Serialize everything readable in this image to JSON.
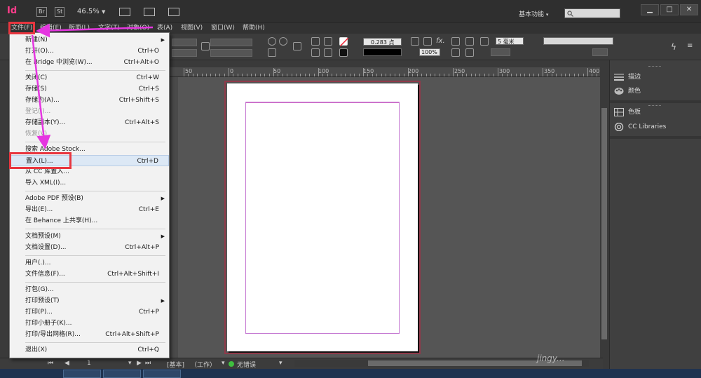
{
  "titlebar": {
    "logo": "Id",
    "br_label": "Br",
    "st_label": "St",
    "zoom": "46.5%",
    "workspace": "基本功能",
    "search_placeholder": ""
  },
  "window_controls": {
    "minimize": "▁",
    "maximize": "□",
    "close": "✕"
  },
  "menubar": {
    "items": [
      "文件(F)",
      "编辑(E)",
      "版面(L)",
      "文字(T)",
      "对象(O)",
      "表(A)",
      "视图(V)",
      "窗口(W)",
      "帮助(H)"
    ]
  },
  "control_bar": {
    "stroke_weight": "0.283 点",
    "opacity": "100%",
    "size": "5 毫米"
  },
  "ruler": {
    "labels": [
      "50",
      "0",
      "50",
      "100",
      "150",
      "200",
      "250",
      "300",
      "350",
      "400"
    ]
  },
  "panels": {
    "items": [
      {
        "label": "描边",
        "icon": "stroke-lines-icon"
      },
      {
        "label": "颜色",
        "icon": "color-palette-icon"
      },
      {
        "label": "色板",
        "icon": "swatches-grid-icon"
      },
      {
        "label": "CC Libraries",
        "icon": "cc-libraries-icon"
      }
    ]
  },
  "file_menu": {
    "items": [
      {
        "label": "新建(N)",
        "shortcut": "",
        "submenu": true
      },
      {
        "label": "打开(O)...",
        "shortcut": "Ctrl+O"
      },
      {
        "label": "在 Bridge 中浏览(W)...",
        "shortcut": "Ctrl+Alt+O"
      },
      {
        "sep": true
      },
      {
        "label": "关闭(C)",
        "shortcut": "Ctrl+W"
      },
      {
        "label": "存储(S)",
        "shortcut": "Ctrl+S"
      },
      {
        "label": "存储为(A)...",
        "shortcut": "Ctrl+Shift+S"
      },
      {
        "label": "登记(I)...",
        "shortcut": "",
        "disabled": true
      },
      {
        "label": "存储副本(Y)...",
        "shortcut": "Ctrl+Alt+S"
      },
      {
        "label": "恢复(V)",
        "shortcut": "",
        "disabled": true
      },
      {
        "sep": true
      },
      {
        "label": "搜索 Adobe Stock...",
        "shortcut": ""
      },
      {
        "label": "置入(L)...",
        "shortcut": "Ctrl+D",
        "highlight": true
      },
      {
        "label": "从 CC 库置入...",
        "shortcut": ""
      },
      {
        "label": "导入 XML(I)...",
        "shortcut": ""
      },
      {
        "sep": true
      },
      {
        "label": "Adobe PDF 预设(B)",
        "shortcut": "",
        "submenu": true
      },
      {
        "label": "导出(E)...",
        "shortcut": "Ctrl+E"
      },
      {
        "label": "在 Behance 上共享(H)...",
        "shortcut": ""
      },
      {
        "sep": true
      },
      {
        "label": "文档预设(M)",
        "shortcut": "",
        "submenu": true
      },
      {
        "label": "文档设置(D)...",
        "shortcut": "Ctrl+Alt+P"
      },
      {
        "sep": true
      },
      {
        "label": "用户(.)...",
        "shortcut": ""
      },
      {
        "label": "文件信息(F)...",
        "shortcut": "Ctrl+Alt+Shift+I"
      },
      {
        "sep": true
      },
      {
        "label": "打包(G)...",
        "shortcut": ""
      },
      {
        "label": "打印预设(T)",
        "shortcut": "",
        "submenu": true
      },
      {
        "label": "打印(P)...",
        "shortcut": "Ctrl+P"
      },
      {
        "label": "打印小册子(K)...",
        "shortcut": ""
      },
      {
        "label": "打印/导出网格(R)...",
        "shortcut": "Ctrl+Alt+Shift+P"
      },
      {
        "sep": true
      },
      {
        "label": "退出(X)",
        "shortcut": "Ctrl+Q"
      }
    ]
  },
  "statusbar": {
    "page_number": "1",
    "master": "[基本]",
    "work_state": "（工作）",
    "errors": "无错误"
  },
  "watermark": "jingy..."
}
